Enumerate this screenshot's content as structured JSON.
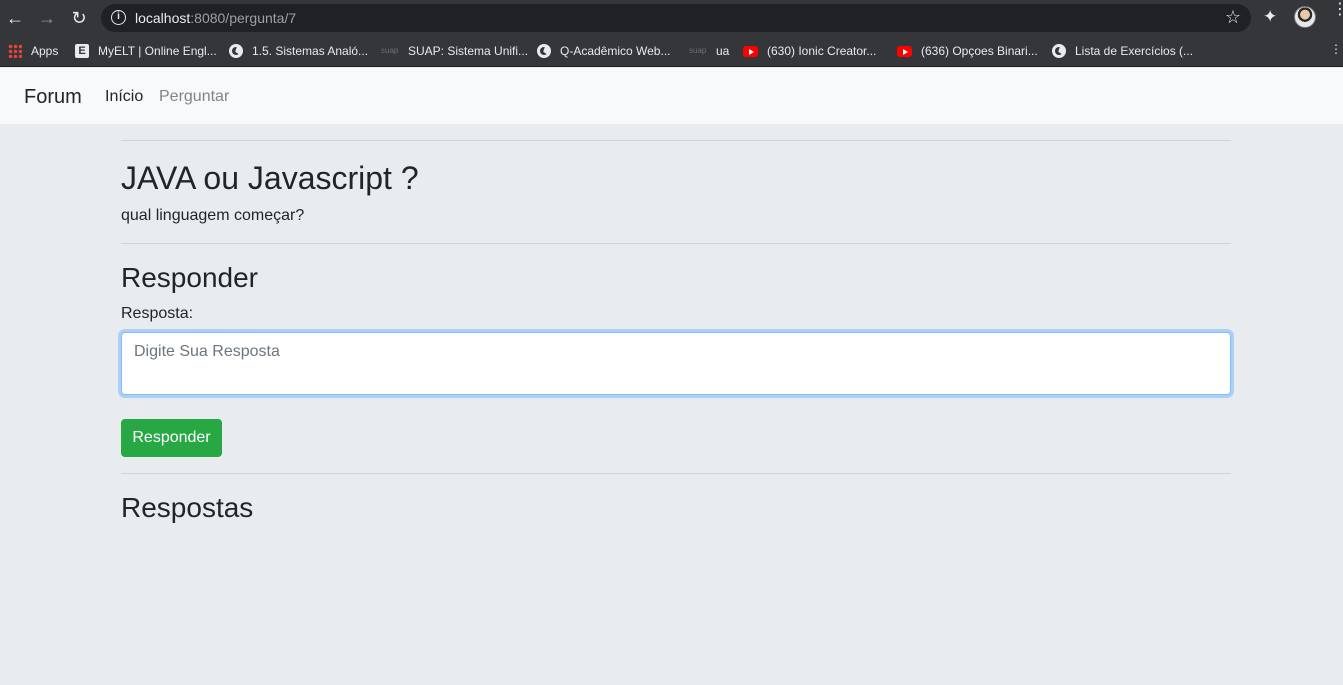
{
  "browser": {
    "url_host": "localhost",
    "url_path": ":8080/pergunta/7",
    "bookmarks": [
      {
        "icon": "apps-icon",
        "label": "Apps"
      },
      {
        "icon": "myelt-icon",
        "label": "MyELT | Online Engl..."
      },
      {
        "icon": "globe-icon",
        "label": "1.5. Sistemas Analó..."
      },
      {
        "icon": "suap-icon",
        "label": "SUAP: Sistema Unifi..."
      },
      {
        "icon": "globe-icon",
        "label": "Q-Acadêmico Web..."
      },
      {
        "icon": "suap-icon",
        "label": "ua"
      },
      {
        "icon": "youtube-icon",
        "label": "(630) Ionic Creator..."
      },
      {
        "icon": "youtube-icon",
        "label": "(636) Opçoes Binari..."
      },
      {
        "icon": "globe-icon",
        "label": "Lista de Exercícios (..."
      }
    ],
    "suap_tag": "suap"
  },
  "navbar": {
    "brand": "Forum",
    "links": [
      {
        "label": "Início"
      },
      {
        "label": "Perguntar"
      }
    ]
  },
  "question": {
    "title": "JAVA ou Javascript ?",
    "description": "qual linguagem começar?"
  },
  "answer_form": {
    "heading": "Responder",
    "label": "Resposta:",
    "placeholder": "Digite Sua Resposta",
    "submit_label": "Responder"
  },
  "answers": {
    "heading": "Respostas"
  },
  "colors": {
    "success": "#28a745",
    "navbar_bg": "#f8f9fa",
    "page_bg": "#e9ecef"
  }
}
